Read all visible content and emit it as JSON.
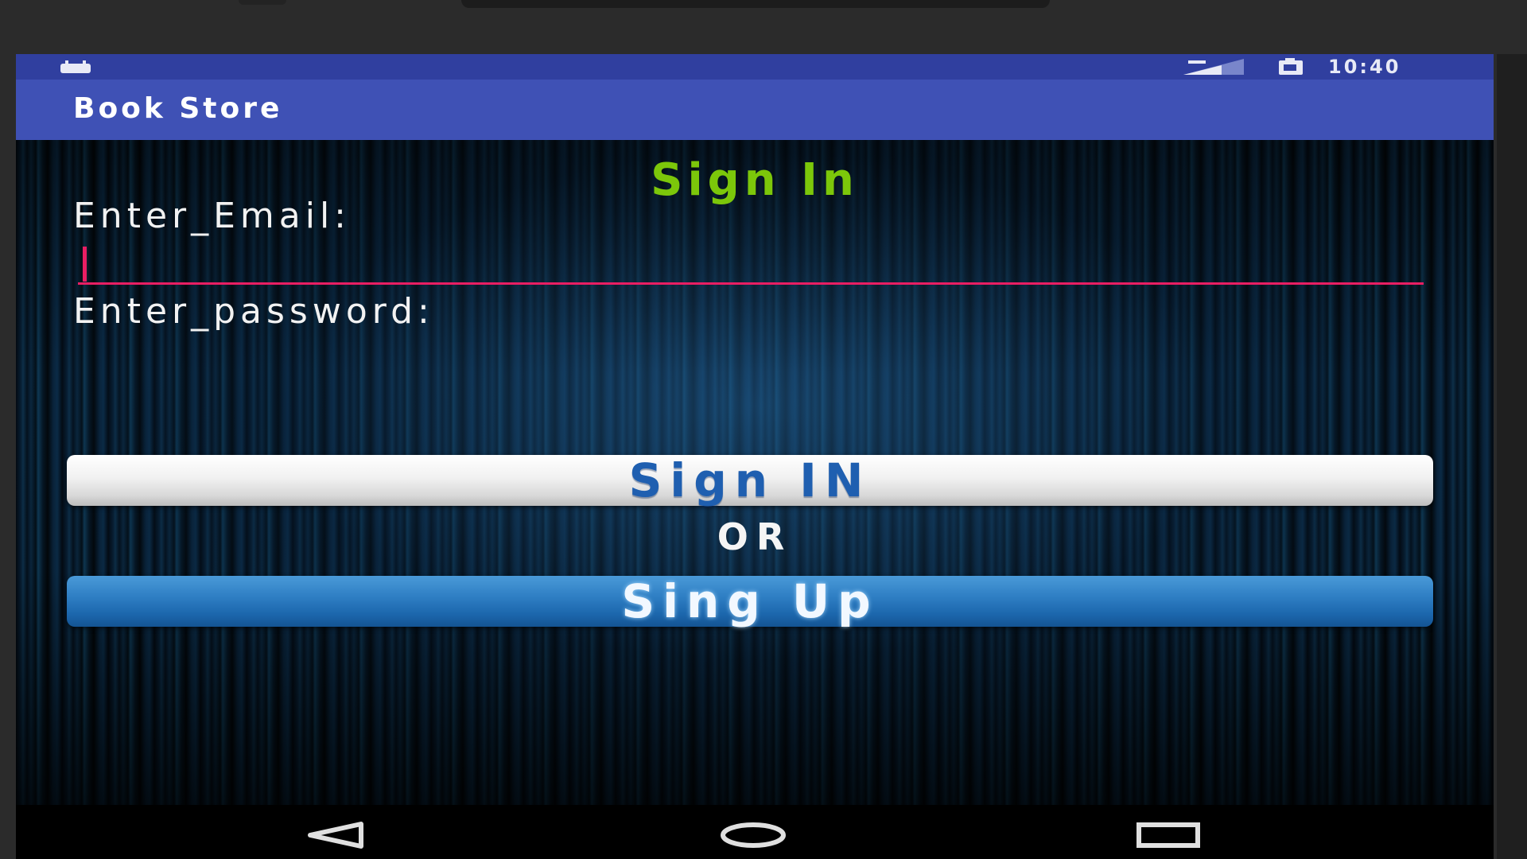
{
  "status_bar": {
    "time": "10:40",
    "left_icon": "android-notification-icon",
    "signal_icon": "signal-strength-icon",
    "battery_icon": "battery-icon",
    "color": "#303f9f"
  },
  "app_bar": {
    "title": "Book Store",
    "color": "#3f51b5"
  },
  "form": {
    "heading": "Sign In",
    "heading_color": "#7cc70a",
    "email_label": "Enter_Email:",
    "email_value": "",
    "email_underline_color": "#e91e63",
    "password_label": "Enter_password:",
    "password_value": "",
    "signin_button": "Sign IN",
    "or_text": "OR",
    "signup_button": "Sing Up"
  },
  "nav_bar": {
    "back_icon": "back-triangle-icon",
    "home_icon": "home-circle-icon",
    "recent_icon": "recent-apps-square-icon"
  }
}
